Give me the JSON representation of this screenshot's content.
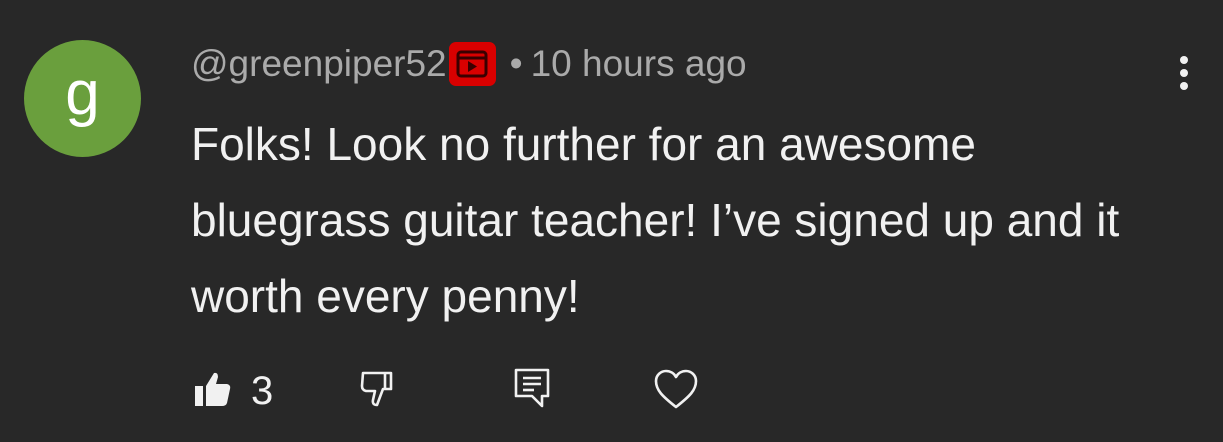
{
  "avatar": {
    "letter": "g",
    "color": "#6a9f3d"
  },
  "comment": {
    "handle": "@greenpiper52",
    "separator": "•",
    "time": "10 hours ago",
    "text": "Folks! Look no further for an awesome bluegrass guitar teacher! I’ve signed up and it worth every penny!"
  },
  "actions": {
    "like_count": "3"
  },
  "icons": {
    "badge": "member-badge-icon",
    "more": "more-vert-icon",
    "like": "thumbs-up-icon",
    "dislike": "thumbs-down-icon",
    "reply": "reply-icon",
    "heart": "heart-icon"
  },
  "colors": {
    "background": "#282828",
    "text": "#f1f1f1",
    "secondary_text": "#aaaaaa",
    "badge": "#d90000"
  }
}
